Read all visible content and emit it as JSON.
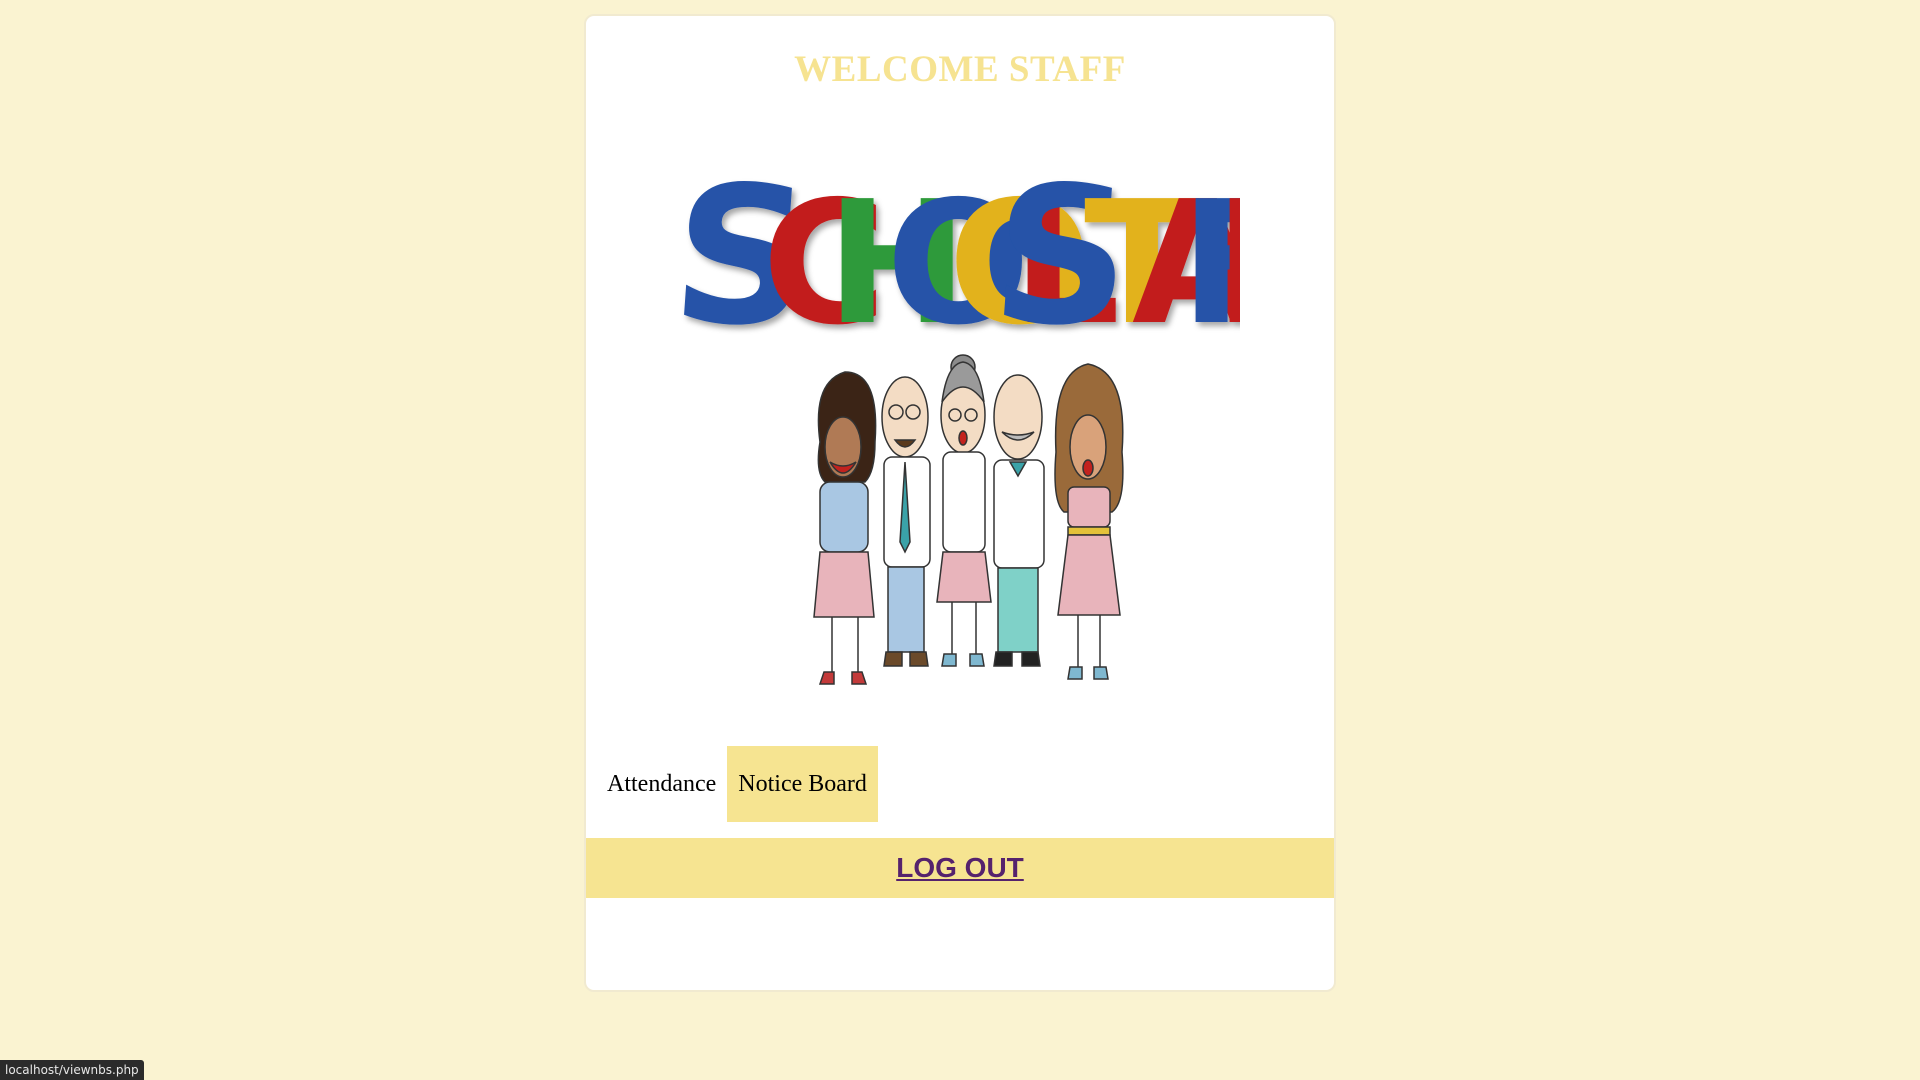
{
  "page": {
    "background_color": "#faf3d1"
  },
  "card": {
    "welcome_title": "WELCOME STAFF",
    "title_color": "#f6e391"
  },
  "hero_image": {
    "wordmark": "SCHOOL STAFF",
    "icon": "school-staff-illustration"
  },
  "nav": {
    "items": [
      {
        "label": "Attendance",
        "active": false
      },
      {
        "label": "Notice Board",
        "active": true
      }
    ],
    "active_color": "#f6e491"
  },
  "logout": {
    "label": "LOG OUT",
    "bar_color": "#f6e491",
    "link_color": "#55226d"
  },
  "status_bar": {
    "url": "localhost/viewnbs.php"
  }
}
